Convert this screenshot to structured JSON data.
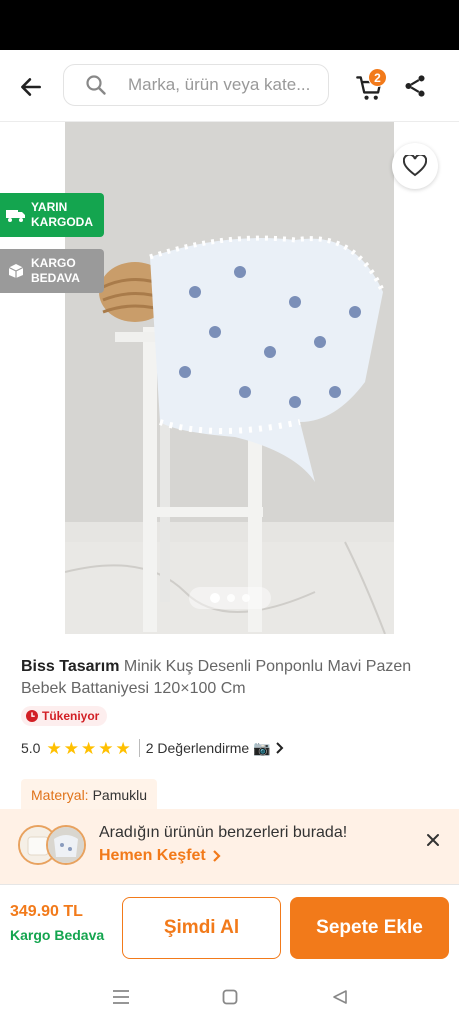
{
  "search": {
    "placeholder": "Marka, ürün veya kate..."
  },
  "header": {
    "cart_count": "2"
  },
  "badges": {
    "next_day": "YARIN KARGODA",
    "free_ship": "KARGO BEDAVA"
  },
  "gallery": {
    "image_count": 3,
    "active_index": 0
  },
  "product": {
    "brand": "Biss Tasarım",
    "name": "Minik Kuş Desenli Ponponlu Mavi Pazen Bebek Battaniyesi 120×100 Cm",
    "stock_status": "Tükeniyor",
    "rating": "5.0",
    "stars": 5,
    "reviews": "2 Değerlendirme 📷",
    "attribute_key": "Materyal:",
    "attribute_value": "Pamuklu"
  },
  "similar": {
    "text": "Aradığın ürünün benzerleri burada!",
    "link": "Hemen Keşfet"
  },
  "bottom": {
    "price": "349.90 TL",
    "shipping": "Kargo Bedava",
    "buy_now": "Şimdi Al",
    "add_to_cart": "Sepete Ekle"
  },
  "colors": {
    "accent": "#f27a1a",
    "green": "#14a54f",
    "stock_red": "#d21f25",
    "star": "#ffc000"
  }
}
